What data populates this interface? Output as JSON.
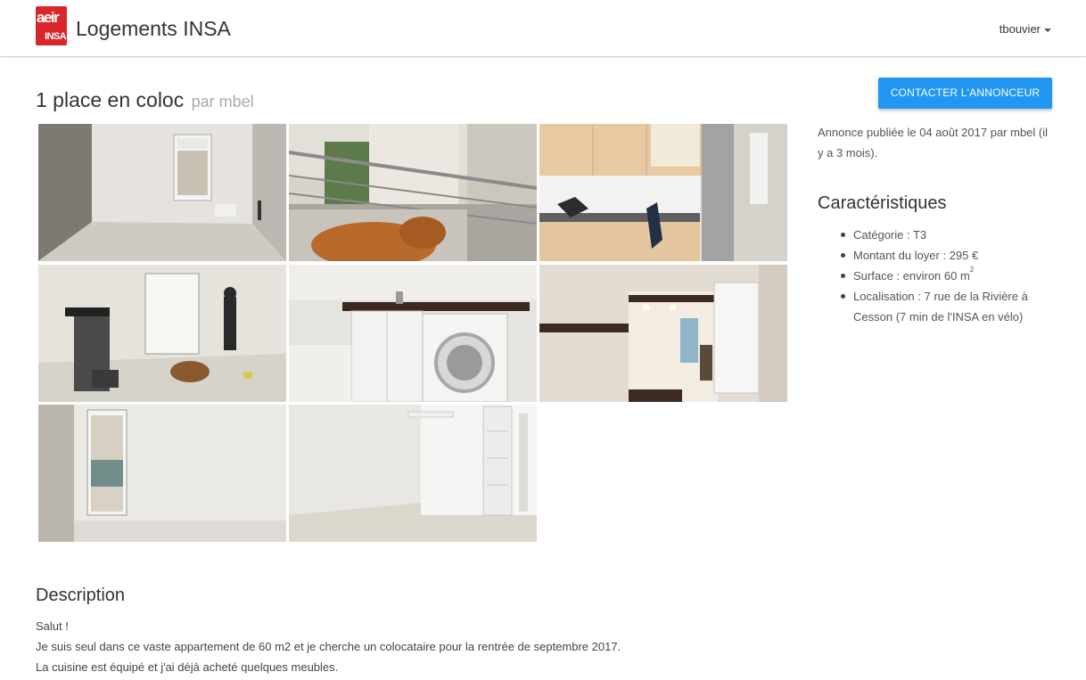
{
  "navbar": {
    "logo_top": "aeir",
    "logo_bottom": "INSA",
    "title": "Logements INSA",
    "user": "tbouvier"
  },
  "listing": {
    "title": "1 place en coloc",
    "by": "par mbel",
    "contact_label": "Contacter l'annonceur",
    "published": "Annonce publiée le 04 août 2017 par mbel (il y a 3 mois)."
  },
  "photos": [
    {
      "subject": "empty room with window"
    },
    {
      "subject": "balcony with dog"
    },
    {
      "subject": "kitchen"
    },
    {
      "subject": "living room with dog and person"
    },
    {
      "subject": "bathroom with washing machine"
    },
    {
      "subject": "bathroom mirror"
    },
    {
      "subject": "empty bedroom with window"
    },
    {
      "subject": "room with closet"
    }
  ],
  "features": {
    "title": "Caractéristiques",
    "category": "Catégorie : T3",
    "rent": "Montant du loyer : 295 €",
    "surface": "Surface : environ 60 m",
    "surface_exp": "2",
    "location": "Localisation : 7 rue de la Rivière à Cesson (7 min de l'INSA en vélo)"
  },
  "description": {
    "title": "Description",
    "lines": [
      "Salut !",
      "Je suis seul dans ce vaste appartement de 60 m2 et je cherche un colocataire pour la rentrée de septembre 2017.",
      "La cuisine est équipé et j'ai déjà acheté quelques meubles."
    ]
  },
  "colors": {
    "accent": "#2196f3",
    "brand": "#d9262c"
  }
}
